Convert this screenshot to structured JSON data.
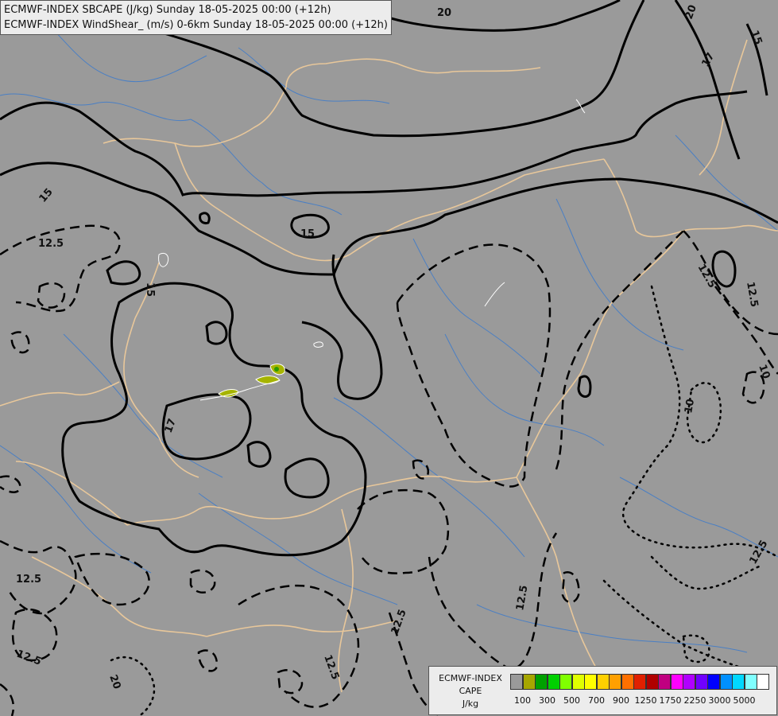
{
  "title": {
    "line1": "ECMWF-INDEX SBCAPE (J/kg) Sunday 18-05-2025 00:00 (+12h)",
    "line2": "ECMWF-INDEX WindShear_ (m/s) 0-6km Sunday 18-05-2025 00:00 (+12h)"
  },
  "map": {
    "background_color": "#9a9a9a",
    "border_color": "#e8c79a",
    "river_color": "#4a7fc4",
    "contour_color": "#000000",
    "contour_labels": [
      "20",
      "20",
      "15",
      "17",
      "15",
      "15",
      "15",
      "12.5",
      "17",
      "12.5",
      "10",
      "12.5",
      "12.5",
      "12.5",
      "12.5",
      "12.5",
      "12.5",
      "10",
      "12.5",
      "20"
    ],
    "cape_blob_colors": [
      "#a6b400",
      "#2a9a00"
    ]
  },
  "legend": {
    "source": "ECMWF-INDEX",
    "field": "CAPE",
    "unit": "J/kg",
    "colors": [
      "#9a9a9a",
      "#a6a600",
      "#00a000",
      "#00d000",
      "#80ff00",
      "#e0ff00",
      "#ffff00",
      "#ffd000",
      "#ffa000",
      "#ff7000",
      "#e02000",
      "#b00000",
      "#c00080",
      "#ff00ff",
      "#b000ff",
      "#7000ff",
      "#0000ff",
      "#0090ff",
      "#00d8ff",
      "#80ffff",
      "#ffffff"
    ],
    "ticks": [
      "100",
      "300",
      "500",
      "700",
      "900",
      "1250",
      "1750",
      "2250",
      "3000",
      "5000"
    ]
  }
}
